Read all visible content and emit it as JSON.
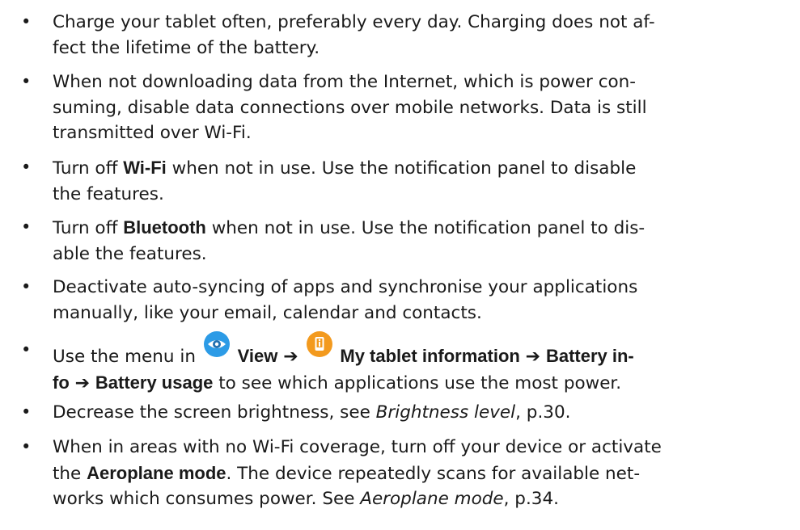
{
  "bullet": "•",
  "arrow": "➔",
  "icons": {
    "view": {
      "name": "eye-icon",
      "color": "#2c9be6"
    },
    "info": {
      "name": "tablet-info-icon",
      "color": "#f39a1e"
    }
  },
  "items": [
    {
      "lines": [
        "Charge your tablet often, preferably every day. Charging does not af-",
        "fect the lifetime of the battery."
      ]
    },
    {
      "lines": [
        "When not downloading data from the Internet, which is power con-",
        "suming, disable data connections over mobile networks. Data is still",
        "transmitted over Wi-Fi."
      ]
    },
    {
      "l1_a": "Turn off ",
      "l1_ui": "Wi-Fi",
      "l1_b": " when not in use. Use the notification panel to disable",
      "l2": "the features."
    },
    {
      "l1_a": "Turn off ",
      "l1_ui": "Bluetooth",
      "l1_b": " when not in use. Use the notification panel to dis-",
      "l2": "able the features."
    },
    {
      "lines": [
        "Deactivate auto-syncing of apps and synchronise your applications",
        "manually, like your email, calendar and contacts."
      ]
    },
    {
      "l1_a": "Use the menu in ",
      "view": "View",
      "info": "My tablet information",
      "battery_info_1": "Battery in-",
      "battery_info_2": "fo",
      "battery_usage": "Battery usage",
      "l2_b": " to see which applications use the most power."
    },
    {
      "a": "Decrease the screen brightness, see ",
      "ref": "Brightness level",
      "b": ", p.30."
    },
    {
      "l1_a": "When in areas with no Wi-Fi coverage, turn off your device or activate",
      "l2_a": "the ",
      "l2_ui": "Aeroplane mode",
      "l2_b": ". The device repeatedly scans for available net-",
      "l3_a": "works which consumes power. See ",
      "l3_ref": "Aeroplane mode",
      "l3_b": ", p.34."
    }
  ]
}
